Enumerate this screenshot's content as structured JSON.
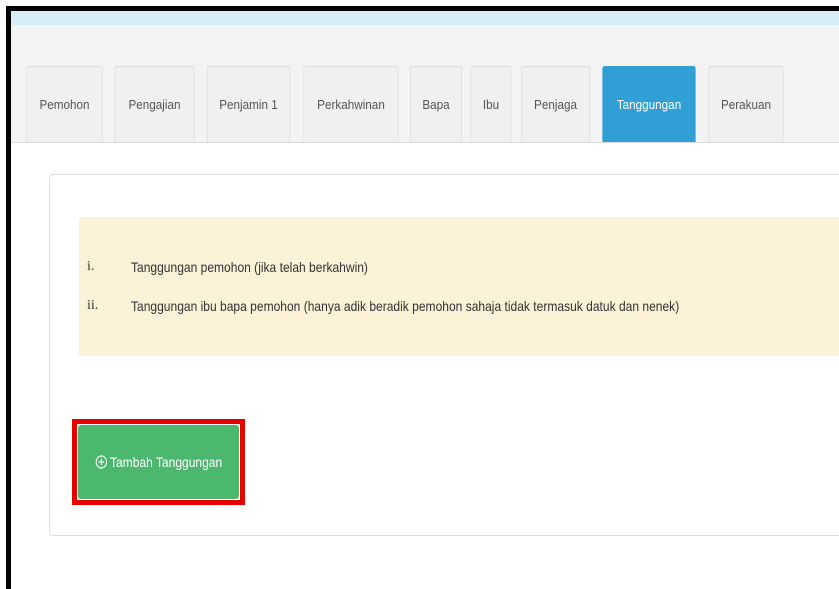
{
  "tabs": [
    {
      "label": "Pemohon",
      "active": false
    },
    {
      "label": "Pengajian",
      "active": false
    },
    {
      "label": "Penjamin 1",
      "active": false
    },
    {
      "label": "Perkahwinan",
      "active": false
    },
    {
      "label": "Bapa",
      "active": false
    },
    {
      "label": "Ibu",
      "active": false
    },
    {
      "label": "Penjaga",
      "active": false
    },
    {
      "label": "Tanggungan",
      "active": true
    },
    {
      "label": "Perakuan",
      "active": false
    }
  ],
  "alert": {
    "items": [
      {
        "num": "i.",
        "text": "Tanggungan pemohon (jika telah berkahwin)"
      },
      {
        "num": "ii.",
        "text": "Tanggungan ibu bapa pemohon (hanya adik beradik pemohon sahaja tidak termasuk datuk dan nenek)"
      }
    ]
  },
  "add_button": {
    "label": "Tambah Tanggungan",
    "icon": "plus-circle-icon"
  },
  "colors": {
    "active_tab": "#2f9fd5",
    "alert_bg": "#fcf2d7",
    "button_bg": "#4cb86e",
    "highlight_border": "#e60000"
  }
}
